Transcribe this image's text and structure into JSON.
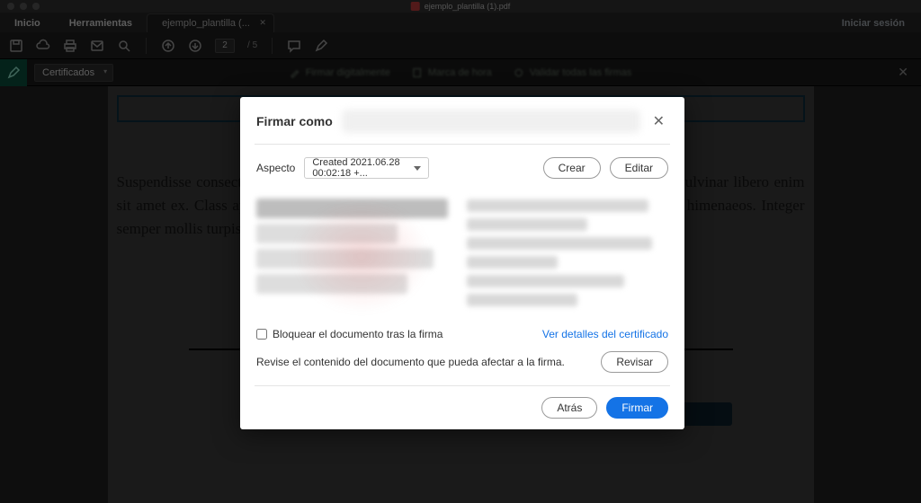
{
  "titlebar": {
    "filename": "ejemplo_plantilla (1).pdf"
  },
  "tabs": {
    "home": "Inicio",
    "tools": "Herramientas",
    "file_tab": "ejemplo_plantilla (...",
    "sign_in": "Iniciar sesión"
  },
  "toolbar": {
    "page_current": "2",
    "page_sep": "/",
    "page_total": "5"
  },
  "certbar": {
    "label": "Certificados",
    "action1": "Firmar digitalmente",
    "action2": "Marca de hora",
    "action3": "Validar todas las firmas"
  },
  "background_text": "Suspendisse consectetur, neque a rhoncus placerat, metus ipsum pellentesque lectus, quis pulvinar libero enim sit amet ex. Class aptent taciti sociosqu ad litora torquent per conubia nostra, per inceptos himenaeos. Integer semper mollis turpis quis rutrum. Suspendisse quis scelerisque nisi congue.",
  "modal": {
    "title": "Firmar como",
    "aspect_label": "Aspecto",
    "aspect_value": "Created 2021.06.28 00:02:18 +...",
    "create_btn": "Crear",
    "edit_btn": "Editar",
    "lock_label": "Bloquear el documento tras la firma",
    "view_cert_link": "Ver detalles del certificado",
    "review_text": "Revise el contenido del documento que pueda afectar a la firma.",
    "review_btn": "Revisar",
    "back_btn": "Atrás",
    "sign_btn": "Firmar"
  }
}
